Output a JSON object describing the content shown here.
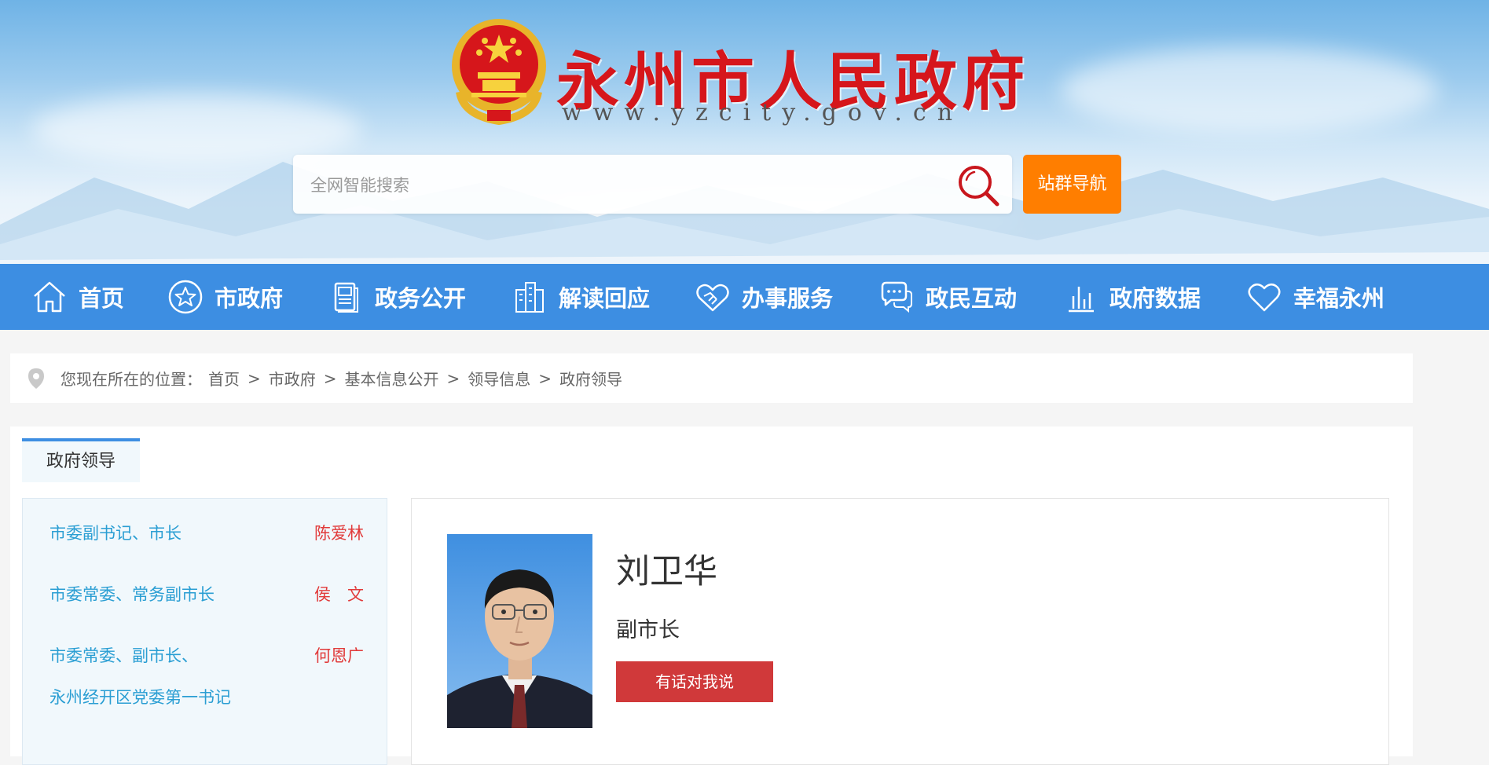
{
  "header": {
    "title": "永州市人民政府",
    "domain": "www.yzcity.gov.cn",
    "search_placeholder": "全网智能搜索",
    "site_nav_label": "站群导航"
  },
  "nav": {
    "items": [
      {
        "label": "首页",
        "icon": "home-icon"
      },
      {
        "label": "市政府",
        "icon": "star-icon"
      },
      {
        "label": "政务公开",
        "icon": "document-icon"
      },
      {
        "label": "解读回应",
        "icon": "building-icon"
      },
      {
        "label": "办事服务",
        "icon": "handshake-icon"
      },
      {
        "label": "政民互动",
        "icon": "chat-icon"
      },
      {
        "label": "政府数据",
        "icon": "bar-chart-icon"
      },
      {
        "label": "幸福永州",
        "icon": "heart-icon"
      }
    ]
  },
  "breadcrumb": {
    "prefix": "您现在所在的位置：",
    "items": [
      "首页",
      "市政府",
      "基本信息公开",
      "领导信息",
      "政府领导"
    ],
    "separator": ">"
  },
  "panel": {
    "tab_label": "政府领导",
    "leaders": [
      {
        "role": "市委副书记、市长",
        "name": "陈爱林"
      },
      {
        "role": "市委常委、常务副市长",
        "name": "侯　文"
      },
      {
        "role": "市委常委、副市长、",
        "role_line2": "永州经开区党委第一书记",
        "name": "何恩广"
      }
    ],
    "detail": {
      "name": "刘卫华",
      "title": "副市长",
      "message_button": "有话对我说"
    }
  },
  "colors": {
    "nav_bg": "#3d8ee2",
    "title_red": "#d6161b",
    "orange_button": "#ff7e00",
    "role_blue": "#2a9ed3",
    "name_red": "#e13a3a",
    "message_button": "#d0393a"
  }
}
